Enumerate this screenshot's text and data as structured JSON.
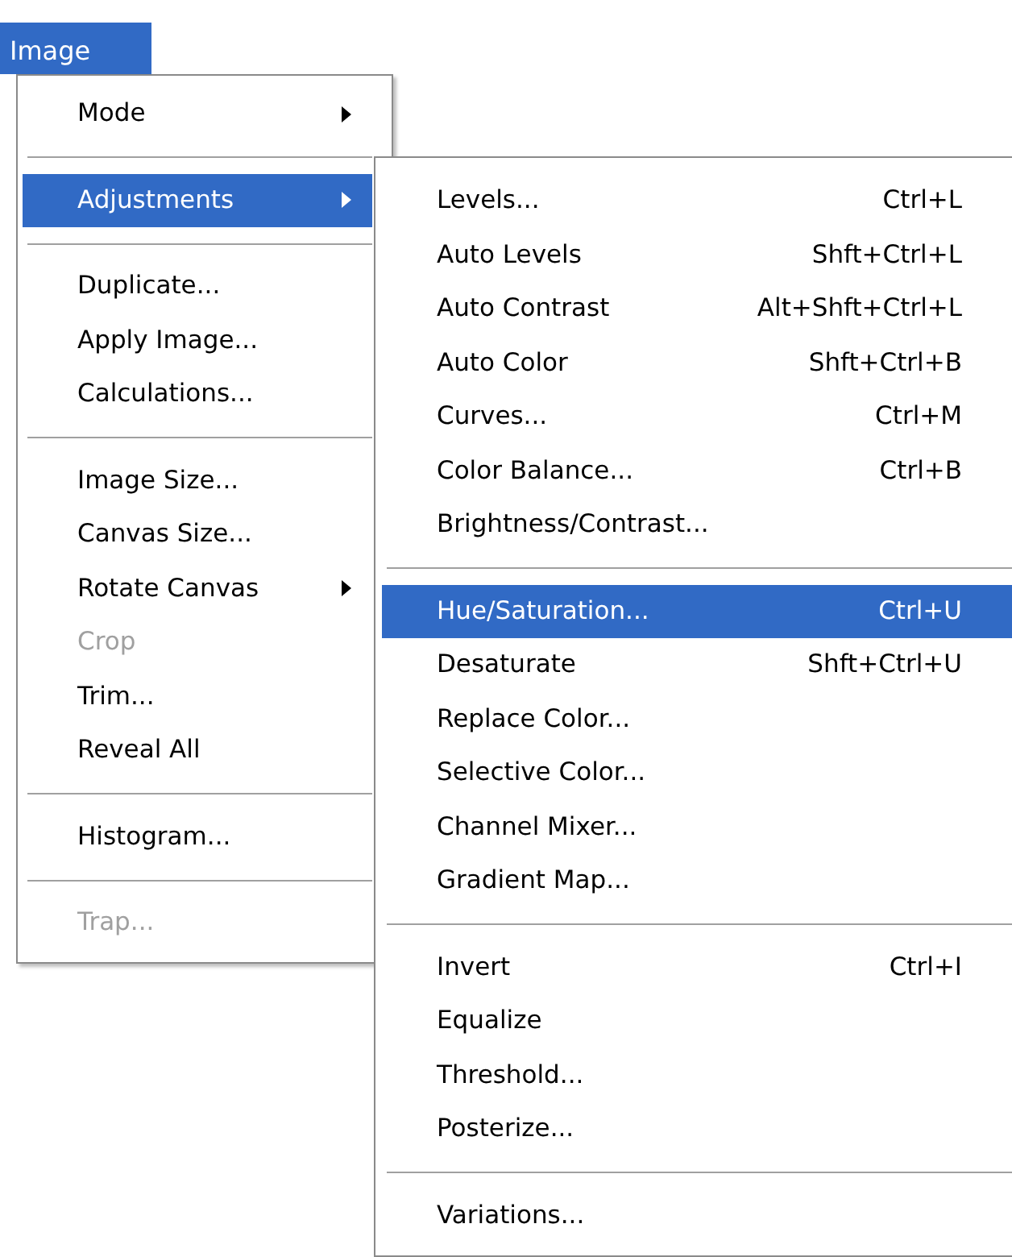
{
  "menu_title": {
    "label": "Image",
    "selected": true
  },
  "menu": {
    "items": [
      {
        "kind": "item",
        "label": "Mode",
        "submenu": true,
        "selected": false,
        "disabled": false
      },
      {
        "kind": "separator"
      },
      {
        "kind": "item",
        "label": "Adjustments",
        "submenu": true,
        "selected": true,
        "disabled": false
      },
      {
        "kind": "separator"
      },
      {
        "kind": "item",
        "label": "Duplicate...",
        "submenu": false,
        "selected": false,
        "disabled": false
      },
      {
        "kind": "item",
        "label": "Apply Image...",
        "submenu": false,
        "selected": false,
        "disabled": false
      },
      {
        "kind": "item",
        "label": "Calculations...",
        "submenu": false,
        "selected": false,
        "disabled": false
      },
      {
        "kind": "separator"
      },
      {
        "kind": "item",
        "label": "Image Size...",
        "submenu": false,
        "selected": false,
        "disabled": false
      },
      {
        "kind": "item",
        "label": "Canvas Size...",
        "submenu": false,
        "selected": false,
        "disabled": false
      },
      {
        "kind": "item",
        "label": "Rotate Canvas",
        "submenu": true,
        "selected": false,
        "disabled": false
      },
      {
        "kind": "item",
        "label": "Crop",
        "submenu": false,
        "selected": false,
        "disabled": true
      },
      {
        "kind": "item",
        "label": "Trim...",
        "submenu": false,
        "selected": false,
        "disabled": false
      },
      {
        "kind": "item",
        "label": "Reveal All",
        "submenu": false,
        "selected": false,
        "disabled": false
      },
      {
        "kind": "separator"
      },
      {
        "kind": "item",
        "label": "Histogram...",
        "submenu": false,
        "selected": false,
        "disabled": false
      },
      {
        "kind": "separator"
      },
      {
        "kind": "item",
        "label": "Trap...",
        "submenu": false,
        "selected": false,
        "disabled": true
      }
    ]
  },
  "submenu": {
    "items": [
      {
        "kind": "item",
        "label": "Levels...",
        "shortcut": "Ctrl+L",
        "selected": false
      },
      {
        "kind": "item",
        "label": "Auto Levels",
        "shortcut": "Shft+Ctrl+L",
        "selected": false
      },
      {
        "kind": "item",
        "label": "Auto Contrast",
        "shortcut": "Alt+Shft+Ctrl+L",
        "selected": false
      },
      {
        "kind": "item",
        "label": "Auto Color",
        "shortcut": "Shft+Ctrl+B",
        "selected": false
      },
      {
        "kind": "item",
        "label": "Curves...",
        "shortcut": "Ctrl+M",
        "selected": false
      },
      {
        "kind": "item",
        "label": "Color Balance...",
        "shortcut": "Ctrl+B",
        "selected": false
      },
      {
        "kind": "item",
        "label": "Brightness/Contrast...",
        "selected": false
      },
      {
        "kind": "separator"
      },
      {
        "kind": "item",
        "label": "Hue/Saturation...",
        "shortcut": "Ctrl+U",
        "selected": true
      },
      {
        "kind": "item",
        "label": "Desaturate",
        "shortcut": "Shft+Ctrl+U",
        "selected": false
      },
      {
        "kind": "item",
        "label": "Replace Color...",
        "selected": false
      },
      {
        "kind": "item",
        "label": "Selective Color...",
        "selected": false
      },
      {
        "kind": "item",
        "label": "Channel Mixer...",
        "selected": false
      },
      {
        "kind": "item",
        "label": "Gradient Map...",
        "selected": false
      },
      {
        "kind": "separator"
      },
      {
        "kind": "item",
        "label": "Invert",
        "shortcut": "Ctrl+I",
        "selected": false
      },
      {
        "kind": "item",
        "label": "Equalize",
        "selected": false
      },
      {
        "kind": "item",
        "label": "Threshold...",
        "selected": false
      },
      {
        "kind": "item",
        "label": "Posterize...",
        "selected": false
      },
      {
        "kind": "separator"
      },
      {
        "kind": "item",
        "label": "Variations...",
        "selected": false
      }
    ]
  }
}
